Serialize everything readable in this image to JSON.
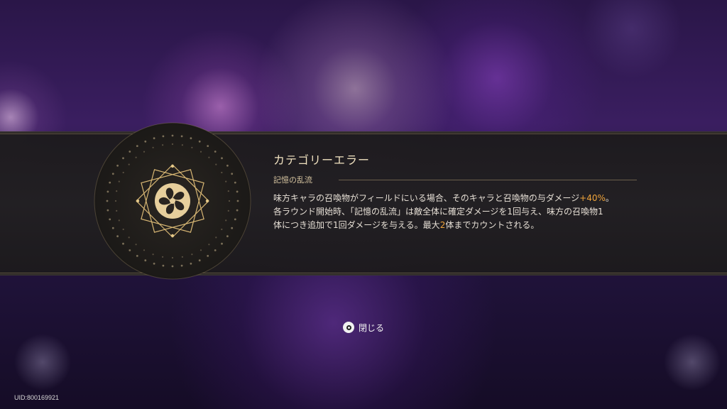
{
  "panel": {
    "title": "カテゴリーエラー",
    "subheading": "記憶の乱流",
    "emblem_icon": "memory-turbulence-emblem-icon",
    "description": {
      "line1_pre": "味方キャラの召喚物がフィールドにいる場合、そのキャラと召喚物の与ダメージ",
      "line1_highlight": "+40%",
      "line1_post": "。",
      "line2": "各ラウンド開始時、「記憶の乱流」は敵全体に確定ダメージを1回与え、味方の召喚物1",
      "line3_pre": "体につき追加で1回ダメージを与える。最大",
      "line3_highlight": "2",
      "line3_post": "体までカウントされる。"
    },
    "highlight_color": "#f0a43a",
    "title_color": "#f1e2c0"
  },
  "close_button": {
    "icon": "circle-button-icon",
    "label": "閉じる"
  },
  "footer": {
    "uid": "UID:800169921"
  }
}
